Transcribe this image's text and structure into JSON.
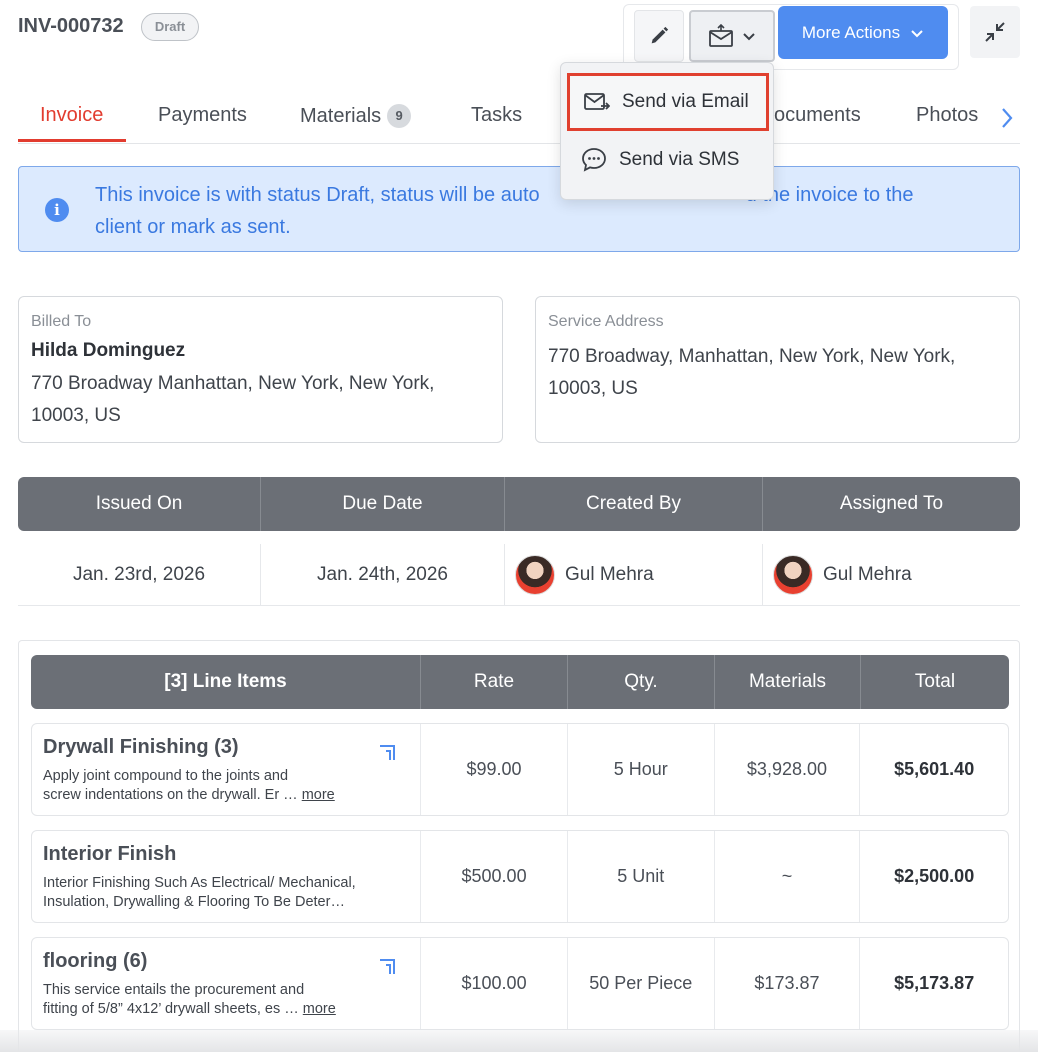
{
  "header": {
    "invoice_id": "INV-000732",
    "status": "Draft",
    "more_actions_label": "More Actions"
  },
  "tabs": [
    {
      "label": "Invoice",
      "active": true
    },
    {
      "label": "Payments"
    },
    {
      "label": "Materials",
      "count": "9"
    },
    {
      "label": "Tasks"
    },
    {
      "label": "Documents"
    },
    {
      "label": "Photos"
    }
  ],
  "tab_documents_visible": "ocuments",
  "banner": {
    "text_before": "This invoice is with status Draft, status will be auto",
    "text_after": "d the invoice to the",
    "text_line2": "client or mark as sent."
  },
  "billed_to": {
    "label": "Billed To",
    "name": "Hilda Dominguez",
    "address_line1": "770 Broadway Manhattan, New York, New York,",
    "address_line2": "10003, US"
  },
  "service_address": {
    "label": "Service Address",
    "address_line1": "770 Broadway, Manhattan, New York, New York,",
    "address_line2": "10003, US"
  },
  "meta": {
    "headers": [
      "Issued On",
      "Due Date",
      "Created By",
      "Assigned To"
    ],
    "issued_on": "Jan. 23rd, 2026",
    "due_date": "Jan. 24th, 2026",
    "created_by": "Gul Mehra",
    "assigned_to": "Gul Mehra"
  },
  "line_items": {
    "headers": [
      "[3] Line Items",
      "Rate",
      "Qty.",
      "Materials",
      "Total"
    ],
    "rows": [
      {
        "name": "Drywall Finishing (3)",
        "desc_line1": "Apply joint compound to the joints and",
        "desc_line2": "screw indentations on the drywall. Er …",
        "more": "more",
        "rate": "$99.00",
        "qty": "5 Hour",
        "materials": "$3,928.00",
        "total": "$5,601.40"
      },
      {
        "name": "Interior Finish",
        "desc_line1": "Interior Finishing Such As Electrical/ Mechanical,",
        "desc_line2": "Insulation, Drywalling & Flooring To Be Deter…",
        "rate": "$500.00",
        "qty": "5 Unit",
        "materials": "~",
        "total": "$2,500.00"
      },
      {
        "name": "flooring (6)",
        "desc_line1": "This service entails the procurement and",
        "desc_line2": "fitting of 5/8” 4x12’ drywall sheets, es …",
        "more": "more",
        "rate": "$100.00",
        "qty": "50 Per Piece",
        "materials": "$173.87",
        "total": "$5,173.87"
      }
    ]
  },
  "dropdown": {
    "items": [
      {
        "label": "Send via Email",
        "icon": "email-send-icon",
        "highlighted": true
      },
      {
        "label": "Send via SMS",
        "icon": "sms-chat-icon"
      }
    ]
  },
  "colors": {
    "accent_red": "#e23c2f",
    "primary_blue": "#4f8cf0",
    "header_gray": "#6b6f76",
    "banner_bg": "#dceafe",
    "banner_text": "#3a79e0"
  }
}
